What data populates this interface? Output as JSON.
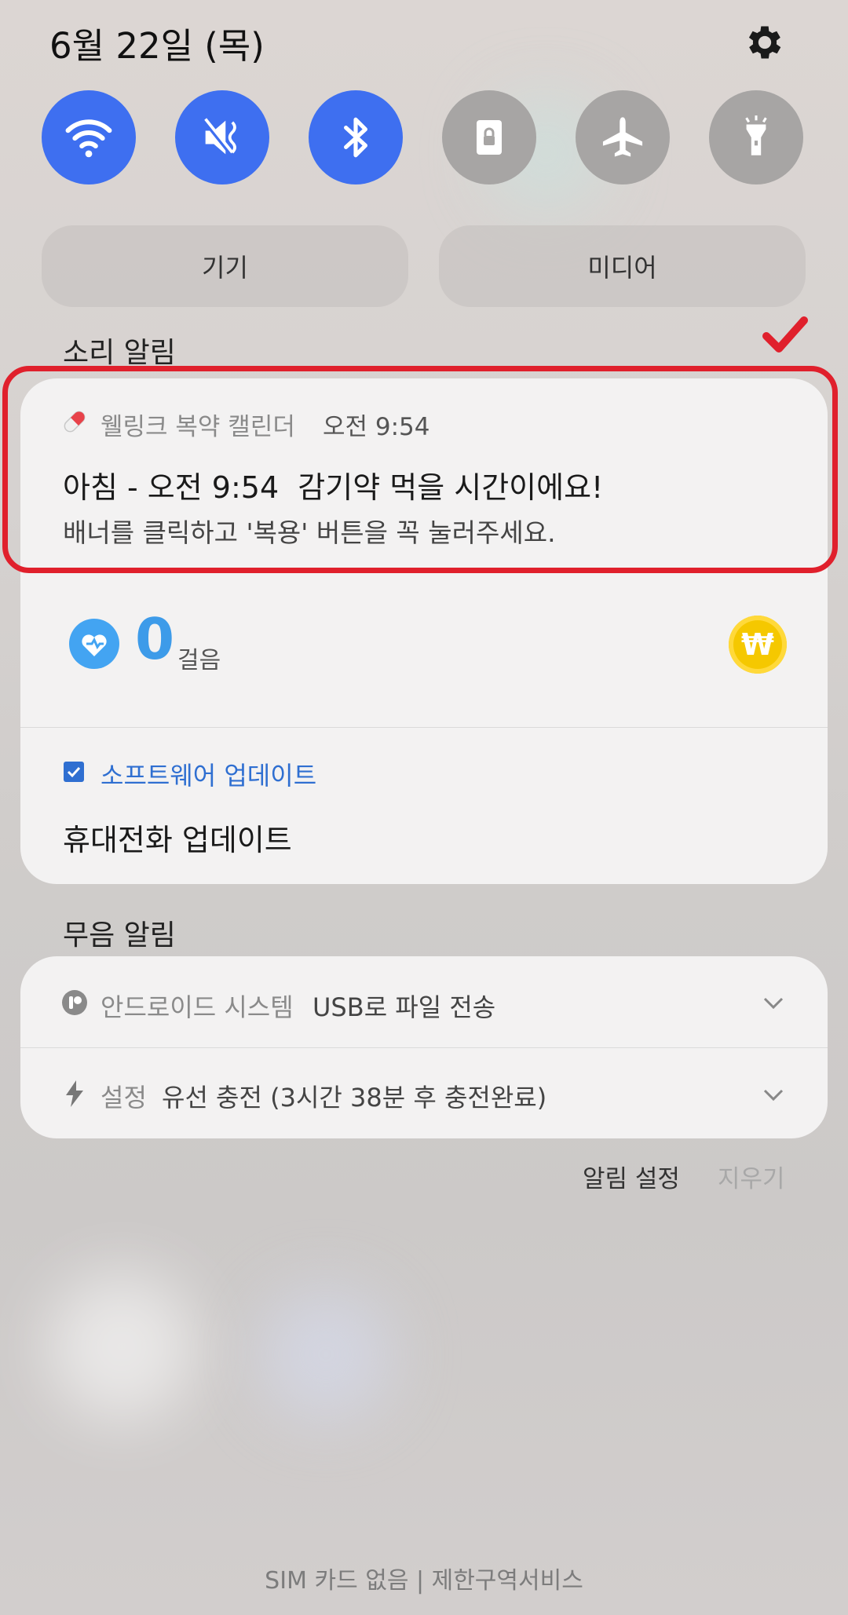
{
  "status": {
    "date": "6월 22일 (목)"
  },
  "quick_settings": [
    {
      "name": "wifi",
      "on": true
    },
    {
      "name": "mute",
      "on": true
    },
    {
      "name": "bluetooth",
      "on": true
    },
    {
      "name": "screen-lock",
      "on": false
    },
    {
      "name": "airplane",
      "on": false
    },
    {
      "name": "flashlight",
      "on": false
    }
  ],
  "output_buttons": {
    "device": "기기",
    "media": "미디어"
  },
  "sound_section": {
    "label": "소리 알림"
  },
  "med_notification": {
    "app": "웰링크 복약 캘린더",
    "time": "오전 9:54",
    "title": "아침 - 오전 9:54  감기약 먹을 시간이에요!",
    "body": "배너를 클릭하고 '복용' 버튼을 꼭 눌러주세요."
  },
  "steps": {
    "count": "0",
    "unit": "걸음",
    "coin_symbol": "₩"
  },
  "software_update": {
    "app": "소프트웨어 업데이트",
    "title": "휴대전화 업데이트"
  },
  "silent_section": {
    "label": "무음 알림"
  },
  "silent_notifications": [
    {
      "app": "안드로이드 시스템",
      "text": "USB로 파일 전송"
    },
    {
      "app": "설정",
      "text": "유선 충전 (3시간 38분 후 충전완료)"
    }
  ],
  "actions": {
    "settings": "알림 설정",
    "clear": "지우기"
  },
  "footer": {
    "text": "SIM 카드 없음 | 제한구역서비스"
  },
  "colors": {
    "accent": "#3e6ff0",
    "highlight": "#e0202c",
    "coin": "#f5c800"
  }
}
